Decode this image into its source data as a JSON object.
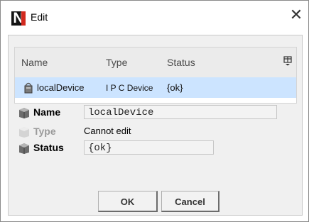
{
  "window": {
    "title": "Edit",
    "close_glyph": "✕"
  },
  "table": {
    "columns": [
      "Name",
      "Type",
      "Status"
    ],
    "rows": [
      {
        "name": "localDevice",
        "type": "I P C Device",
        "status": "{ok}"
      }
    ]
  },
  "properties": {
    "name": {
      "label": "Name",
      "value": "localDevice"
    },
    "type": {
      "label": "Type",
      "value": "Cannot edit"
    },
    "status": {
      "label": "Status",
      "value": "{ok}"
    }
  },
  "buttons": {
    "ok": "OK",
    "cancel": "Cancel"
  },
  "colors": {
    "selected_row": "#cce4ff",
    "dialog_background": "#f0f0f0",
    "logo_red": "#d22a1f"
  },
  "icons": {
    "app": "niagara-n-logo",
    "row": "device-icon",
    "property": "slot-cube-icon",
    "column_chooser": "table-options-icon"
  }
}
